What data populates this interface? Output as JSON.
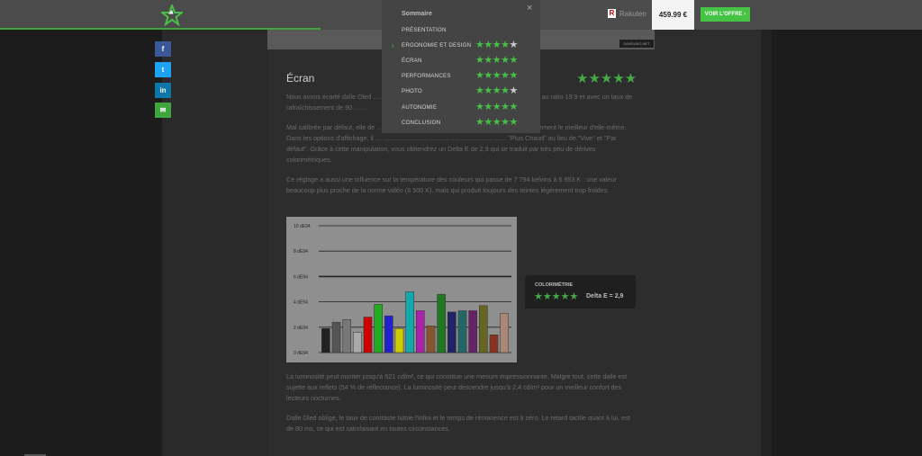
{
  "header": {
    "retailer_logo": "R",
    "retailer_name": "Rakuten",
    "price": "459.99 €",
    "offer_label": "VOIR L'OFFRE ›",
    "brand_color": "#3fa53f"
  },
  "social": {
    "facebook": "f",
    "twitter": "t",
    "linkedin": "in",
    "mail": "✉"
  },
  "hero": {
    "tag": "SAMSUNG.NET"
  },
  "section": {
    "title": "Écran",
    "rating": "★★★★★"
  },
  "paragraphs": {
    "p1": "Nous avons écarté dalle Oled ……………………………… (Full HD (2 400 x 1 080 pixels) au ratio 19:9 et avec un taux de rafraîchissement de 90 ……",
    "p2": "Mal calibrée par défaut, elle de …………………………………… ne montre pas immédiatement le meilleur d'elle-même. Dans les options d'affichage, il … ………………………………………………… \"Plus Chaud\" au lieu de \"Vive\" et \"Par défaut\". Grâce à cette manipulation, vous obtiendrez un Delta E de 2,9 qui se traduit par très peu de dérives colorimétriques.",
    "p3": "Ce réglage a aussi une influence sur la température des couleurs qui passe de 7 794 kelvins à 6 953 K : une valeur beaucoup plus proche de la norme vidéo (6 500 K), mais qui produit toujours des teintes légèrement trop froides.",
    "p4": "La luminosité peut monter jusqu'à 621 cd/m², ce qui constitue une mesure impressionnante. Malgré tout, cette dalle est sujette aux reflets (54 % de réflectance). La luminosité peut descendre jusqu'à 2,4 cd/m² pour un meilleur confort des lecteurs nocturnes.",
    "p5": "Dalle Oled oblige, le taux de contraste tutoie l'infini et le temps de rémanence est à zéro. Le retard tactile quant à lui, est de 80 ms, ce qui est satisfaisant en toutes circonstances."
  },
  "chart_data": {
    "type": "bar",
    "y_ticks": [
      "10 dE94",
      "8 dE94",
      "6 dE94",
      "4 dE94",
      "2 dE94",
      "0 dE94"
    ],
    "ylim": [
      0,
      10
    ],
    "grid": true,
    "values": [
      1.9,
      2.4,
      2.6,
      1.6,
      2.8,
      3.8,
      2.9,
      1.9,
      4.8,
      3.3,
      2.1,
      4.6,
      3.2,
      3.3,
      3.3,
      3.7,
      1.4,
      3.1
    ],
    "colors": [
      "#222222",
      "#555555",
      "#777777",
      "#aaaaaa",
      "#cc0000",
      "#22aa22",
      "#2222cc",
      "#cccc00",
      "#11aaaa",
      "#aa22aa",
      "#885533",
      "#227722",
      "#222266",
      "#226666",
      "#662266",
      "#666622",
      "#883322",
      "#aa8877"
    ]
  },
  "card": {
    "title": "COLORIMÉTRIE",
    "stars": "★★★★★",
    "value": "Delta E = 2,9"
  },
  "summary": {
    "title": "Sommaire",
    "close": "×",
    "active_mark": "›",
    "items": [
      {
        "label": "PRÉSENTATION",
        "stars_on": "",
        "stars_off": ""
      },
      {
        "label": "ERGONOMIE ET DESIGN",
        "stars_on": "★★★★",
        "stars_off": "★"
      },
      {
        "label": "ÉCRAN",
        "stars_on": "★★★★★",
        "stars_off": ""
      },
      {
        "label": "PERFORMANCES",
        "stars_on": "★★★★★",
        "stars_off": ""
      },
      {
        "label": "PHOTO",
        "stars_on": "★★★★",
        "stars_off": "★"
      },
      {
        "label": "AUTONOMIE",
        "stars_on": "★★★★★",
        "stars_off": ""
      },
      {
        "label": "CONCLUSION",
        "stars_on": "★★★★★",
        "stars_off": ""
      }
    ]
  }
}
